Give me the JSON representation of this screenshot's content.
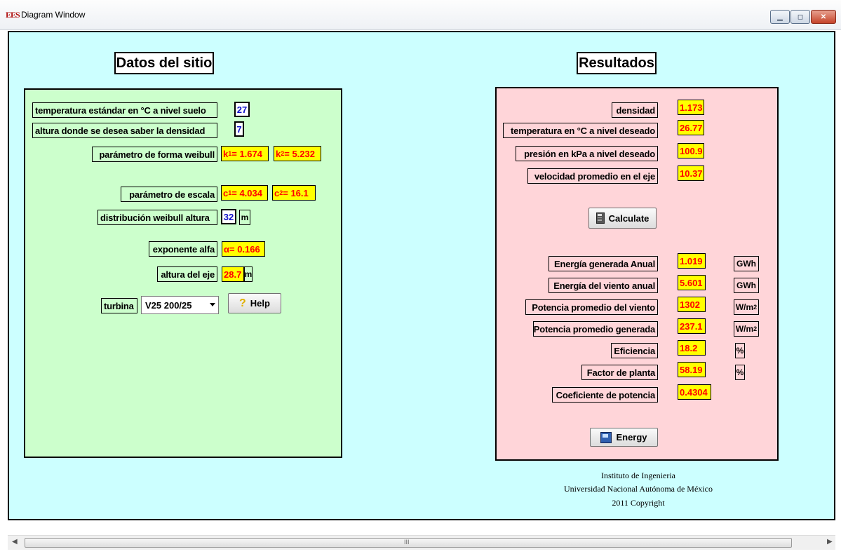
{
  "window": {
    "title": "Diagram Window",
    "icon": "ees-app-icon",
    "icon_text": "EES"
  },
  "left": {
    "header": "Datos del sitio",
    "temp_label": "temperatura estándar en °C a nivel suelo",
    "temp_value": "27",
    "height_label": "altura donde se desea saber la densidad",
    "height_value": "7",
    "shape_label": "parámetro de forma weibull",
    "k1": {
      "prefix": "k",
      "sub": "1",
      "rest": " = 1.674"
    },
    "k2": {
      "prefix": "k",
      "sub": "2",
      "rest": " = 5.232"
    },
    "scale_label": "parámetro de escala",
    "c1": {
      "prefix": "c",
      "sub": "1",
      "rest": " = 4.034"
    },
    "c2": {
      "prefix": "c",
      "sub": "2",
      "rest": " = 16.1"
    },
    "weibull_height_label": "distribución weibull altura",
    "weibull_height_value": "32",
    "weibull_height_unit": "m",
    "alpha_label": "exponente alfa",
    "alpha_value": "α= 0.166",
    "axis_height_label": "altura del eje",
    "axis_height_value": "28.7",
    "axis_height_unit": "m",
    "turbine_label": "turbina",
    "turbine_selected": "V25 200/25",
    "help_button": "Help"
  },
  "right": {
    "header": "Resultados",
    "rows_top": [
      {
        "label": "densidad",
        "value": "1.173"
      },
      {
        "label": "temperatura en °C a nivel deseado",
        "value": "26.77"
      },
      {
        "label": "presión en kPa a nivel deseado",
        "value": "100.9"
      },
      {
        "label": "velocidad promedio en el eje",
        "value": "10.37"
      }
    ],
    "calculate_button": "Calculate",
    "rows_bottom": [
      {
        "label": "Energía generada Anual",
        "value": "1.019",
        "unit": "GWh"
      },
      {
        "label": "Energía del viento anual",
        "value": "5.601",
        "unit": "GWh"
      },
      {
        "label": "Potencia promedio del viento",
        "value": "1302",
        "unit": "W/m",
        "unit_sup": "2"
      },
      {
        "label": "Potencia promedio generada",
        "value": "237.1",
        "unit": "W/m",
        "unit_sup": "2"
      },
      {
        "label": "Eficiencia",
        "value": "18.2",
        "unit": "%"
      },
      {
        "label": "Factor de planta",
        "value": "58.19",
        "unit": "%"
      },
      {
        "label": "Coeficiente de potencia",
        "value": "0.4304"
      }
    ],
    "energy_button": "Energy"
  },
  "footer": {
    "line1": "Instituto de Ingenieria",
    "line2": "Universidad Nacional Autónoma de México",
    "line3": "2011 Copyright"
  },
  "scrollbar": {
    "grip": "III"
  }
}
